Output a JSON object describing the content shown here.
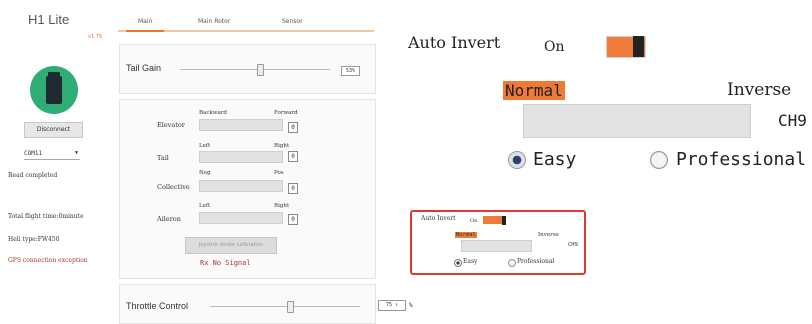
{
  "app": {
    "title": "H1 Lite",
    "version": "v1.75"
  },
  "sidebar": {
    "disconnect_label": "Disconnect",
    "com_port": "COM11",
    "read_status": "Read completed",
    "flight_time": "Total flight time:0minute",
    "heli_type": "Heli type:FW450",
    "gps_status": "GPS connection exception"
  },
  "tabs": [
    {
      "label": "Main",
      "active": true
    },
    {
      "label": "Main Rotor",
      "active": false
    },
    {
      "label": "Sensor",
      "active": false
    }
  ],
  "tail_gain": {
    "label": "Tail Gain",
    "value": "53%",
    "level": 0.53
  },
  "sticks": [
    {
      "name": "Elevator",
      "left": "Backward",
      "right": "Forward",
      "value": "0"
    },
    {
      "name": "Tail",
      "left": "Left",
      "right": "Right",
      "value": "0"
    },
    {
      "name": "Collective",
      "left": "Neg",
      "right": "Pos",
      "value": "0"
    },
    {
      "name": "Aileron",
      "left": "Left",
      "right": "Right",
      "value": "0"
    }
  ],
  "calibration_button": "Joystick stroke calibration",
  "rx_status": "Rx No Signal",
  "throttle": {
    "label": "Throttle Control",
    "value": "75",
    "unit": "%",
    "level": 0.75
  },
  "auto_invert": {
    "title": "Auto Invert",
    "state": "On",
    "normal_label": "Normal",
    "inverse_label": "Inverse",
    "channel": "CH9",
    "option_easy": "Easy",
    "option_professional": "Professional",
    "selected": "Easy"
  },
  "colors": {
    "accent": "#ef7a3a",
    "highlight_border": "#e03a2e",
    "device": "#2eae74",
    "error": "#b03030"
  }
}
